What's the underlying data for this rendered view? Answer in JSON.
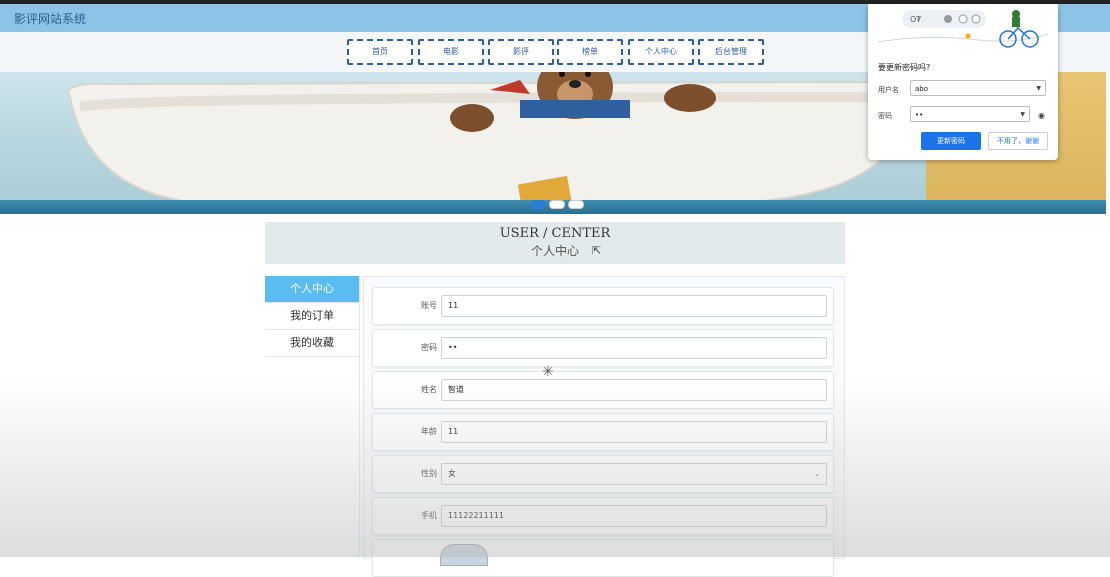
{
  "app": {
    "title": "影评网站系统"
  },
  "nav": {
    "items": [
      {
        "label": "首页"
      },
      {
        "label": "电影"
      },
      {
        "label": "影评"
      },
      {
        "label": "榜单"
      },
      {
        "label": "个人中心"
      },
      {
        "label": "后台管理"
      }
    ]
  },
  "banner": {
    "slides": 3,
    "active_slide": 1
  },
  "password_popup": {
    "title": "要更新密码吗?",
    "username_label": "用户名",
    "username_value": "abo",
    "password_label": "密码",
    "password_value": "••",
    "primary_button": "更新密码",
    "secondary_button": "不用了，谢谢"
  },
  "center_header": {
    "title_en": "USER / CENTER",
    "title_cn": "个人中心"
  },
  "sidebar": {
    "items": [
      {
        "label": "个人中心",
        "active": true
      },
      {
        "label": "我的订单",
        "active": false
      },
      {
        "label": "我的收藏",
        "active": false
      }
    ]
  },
  "form": {
    "fields": [
      {
        "label": "账号",
        "value": "11"
      },
      {
        "label": "密码",
        "value": "••"
      },
      {
        "label": "姓名",
        "value": "智道"
      },
      {
        "label": "年龄",
        "value": "11"
      },
      {
        "label": "性别",
        "value": "女"
      },
      {
        "label": "手机",
        "value": "11122211111"
      }
    ]
  },
  "colors": {
    "titlebar": "#8cc3e6",
    "nav_border": "#2f5d9c",
    "sidebar_active": "#5bbcef",
    "primary_button": "#1a73e8"
  }
}
